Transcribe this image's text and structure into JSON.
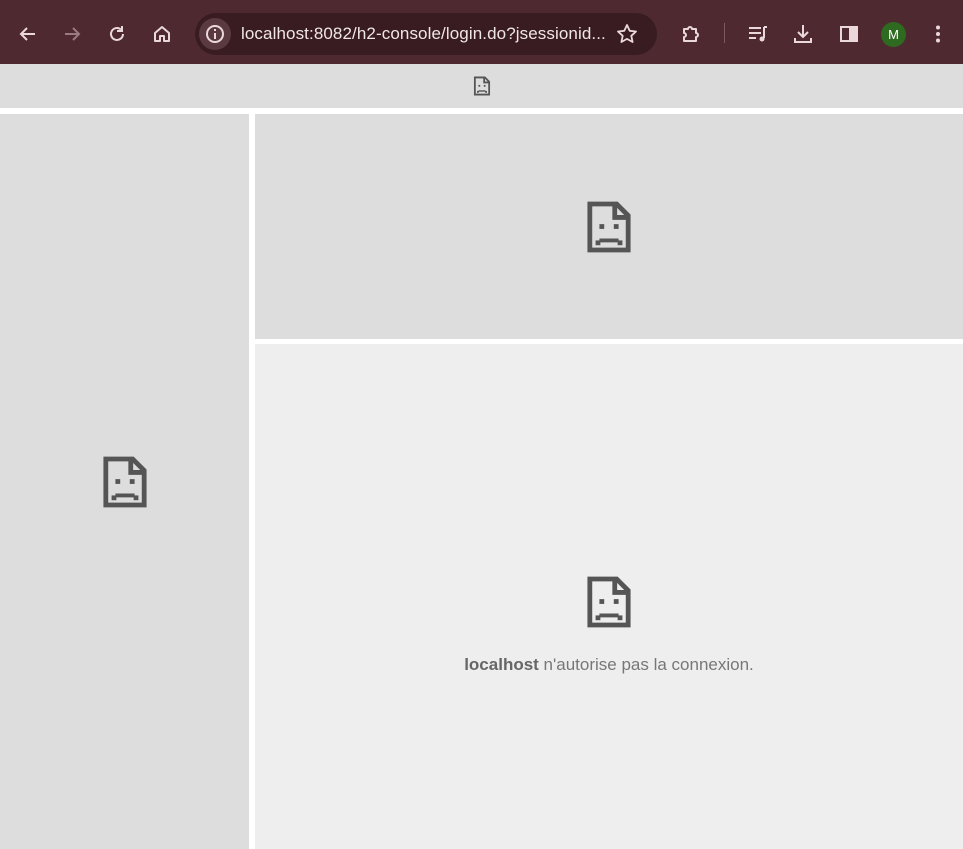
{
  "browser": {
    "url": "localhost:8082/h2-console/login.do?jsessionid...",
    "profile_initial": "M",
    "colors": {
      "toolbar": "#4e2a30",
      "omnibox": "#381c21",
      "avatar": "#2e6b21"
    },
    "icons": [
      "back-arrow-icon",
      "forward-arrow-icon",
      "reload-icon",
      "home-icon",
      "site-info-icon",
      "bookmark-star-icon",
      "extensions-icon",
      "reading-list-icon",
      "download-icon",
      "side-panel-icon",
      "more-menu-icon"
    ]
  },
  "frames": {
    "icon": "broken-page-icon",
    "error": {
      "host": "localhost",
      "message": " n'autorise pas la connexion."
    }
  }
}
